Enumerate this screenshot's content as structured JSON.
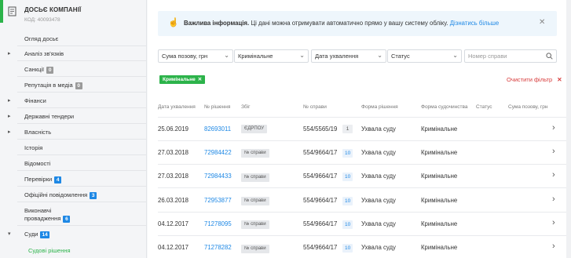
{
  "sidebar": {
    "company_name": "ДОСЬЄ КОМПАНІЇ",
    "company_code": "КОД: 40093478",
    "items": [
      {
        "label": "Огляд досьє",
        "arrow": false,
        "badge": null
      },
      {
        "label": "Аналіз зв'язків",
        "arrow": true,
        "badge": null
      },
      {
        "label": "Санкції",
        "arrow": false,
        "badge": "0",
        "badge_color": "grey"
      },
      {
        "label": "Репутація в медіа",
        "arrow": false,
        "badge": "0",
        "badge_color": "grey"
      },
      {
        "label": "Фінанси",
        "arrow": true,
        "badge": null
      },
      {
        "label": "Державні тендери",
        "arrow": true,
        "badge": null
      },
      {
        "label": "Власність",
        "arrow": true,
        "badge": null
      },
      {
        "label": "Історія",
        "arrow": false,
        "badge": null
      },
      {
        "label": "Відомості",
        "arrow": false,
        "badge": null
      },
      {
        "label": "Перевірки",
        "arrow": false,
        "badge": "4",
        "badge_color": "blue"
      },
      {
        "label": "Офіційні повідомлення",
        "arrow": false,
        "badge": "3",
        "badge_color": "blue"
      },
      {
        "label_line1": "Виконавчі",
        "label": "провадження",
        "arrow": false,
        "badge": "6",
        "badge_color": "blue"
      },
      {
        "label": "Суди",
        "arrow": true,
        "badge": "14",
        "badge_color": "blue"
      },
      {
        "label": "Судові рішення",
        "arrow": false,
        "badge": null,
        "active": true
      }
    ]
  },
  "info": {
    "title": "Важлива інформація.",
    "text": "Ці дані можна отримувати автоматично прямо у вашу систему обліку.",
    "link": "Дізнатись більше"
  },
  "filters": {
    "amount": "Сума позову, грн",
    "type": "Кримінальне",
    "date": "Дата ухвалення",
    "status": "Статус",
    "case_number_placeholder": "Номер справи"
  },
  "active_chip": "Кримінальне",
  "clear_filter": "Очистити фільтр",
  "table": {
    "headers": [
      "Дата ухвалення",
      "№ рішення",
      "Збіг",
      "№ справи",
      "Форма рішення",
      "Форма судочинства",
      "Статус",
      "Сума позову, грн"
    ],
    "rows": [
      {
        "date": "25.06.2019",
        "decision": "82693011",
        "match": "ЄДРПОУ",
        "case": "554/5565/19",
        "count": "1",
        "form": "Ухвала суду",
        "proceeding": "Кримінальне"
      },
      {
        "date": "27.03.2018",
        "decision": "72984422",
        "match": "№ справи",
        "case": "554/9664/17",
        "count": "10",
        "form": "Ухвала суду",
        "proceeding": "Кримінальне"
      },
      {
        "date": "27.03.2018",
        "decision": "72984433",
        "match": "№ справи",
        "case": "554/9664/17",
        "count": "10",
        "form": "Ухвала суду",
        "proceeding": "Кримінальне"
      },
      {
        "date": "26.03.2018",
        "decision": "72953877",
        "match": "№ справи",
        "case": "554/9664/17",
        "count": "10",
        "form": "Ухвала суду",
        "proceeding": "Кримінальне"
      },
      {
        "date": "04.12.2017",
        "decision": "71278095",
        "match": "№ справи",
        "case": "554/9664/17",
        "count": "10",
        "form": "Ухвала суду",
        "proceeding": "Кримінальне"
      },
      {
        "date": "04.12.2017",
        "decision": "71278282",
        "match": "№ справи",
        "case": "554/9664/17",
        "count": "10",
        "form": "Ухвала суду",
        "proceeding": "Кримінальне"
      }
    ]
  },
  "colors": {
    "accent": "#2cb34a",
    "link": "#1e88e5",
    "danger": "#d73a3a"
  }
}
